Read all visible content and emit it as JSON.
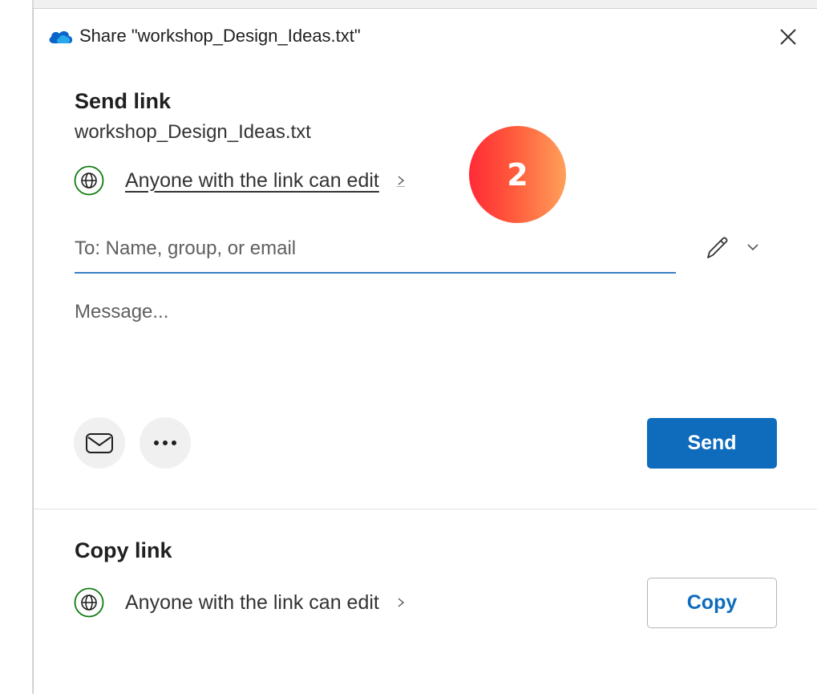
{
  "dialog": {
    "title": "Share \"workshop_Design_Ideas.txt\"",
    "close_icon": "close-icon"
  },
  "send_link": {
    "heading": "Send link",
    "file_name": "workshop_Design_Ideas.txt",
    "permission": "Anyone with the link can edit",
    "to_placeholder": "To: Name, group, or email",
    "message_placeholder": "Message...",
    "send_label": "Send"
  },
  "copy_link": {
    "heading": "Copy link",
    "permission": "Anyone with the link can edit",
    "copy_label": "Copy"
  },
  "annotation": {
    "step_number": "2"
  },
  "colors": {
    "accent": "#0f6cbd",
    "globe": "#107c10",
    "badge_start": "#ff2a36",
    "badge_end": "#ffa05a"
  }
}
